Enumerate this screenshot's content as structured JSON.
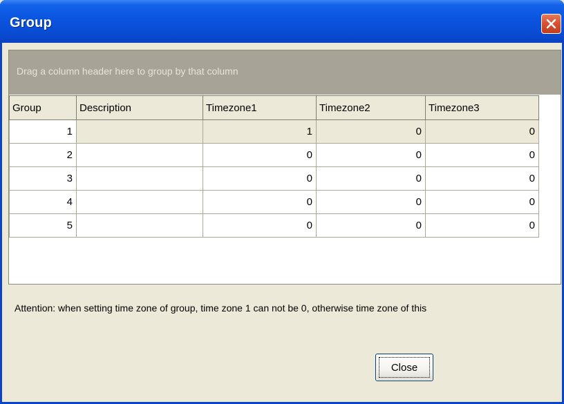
{
  "window": {
    "title": "Group",
    "close_icon": "close-icon",
    "colors": {
      "titlebar": "#0a54e0",
      "close": "#d95332",
      "face": "#ece9d8"
    }
  },
  "grid": {
    "group_hint": "Drag a column header here to group by that column",
    "columns": [
      "Group",
      "Description",
      "Timezone1",
      "Timezone2",
      "Timezone3"
    ],
    "rows": [
      {
        "group": "1",
        "description": "",
        "tz1": "1",
        "tz2": "0",
        "tz3": "0"
      },
      {
        "group": "2",
        "description": "",
        "tz1": "0",
        "tz2": "0",
        "tz3": "0"
      },
      {
        "group": "3",
        "description": "",
        "tz1": "0",
        "tz2": "0",
        "tz3": "0"
      },
      {
        "group": "4",
        "description": "",
        "tz1": "0",
        "tz2": "0",
        "tz3": "0"
      },
      {
        "group": "5",
        "description": "",
        "tz1": "0",
        "tz2": "0",
        "tz3": "0"
      }
    ]
  },
  "attention_text": "Attention: when setting time zone of group, time zone 1 can not be 0, otherwise time zone of this",
  "buttons": {
    "close_label": "Close"
  }
}
